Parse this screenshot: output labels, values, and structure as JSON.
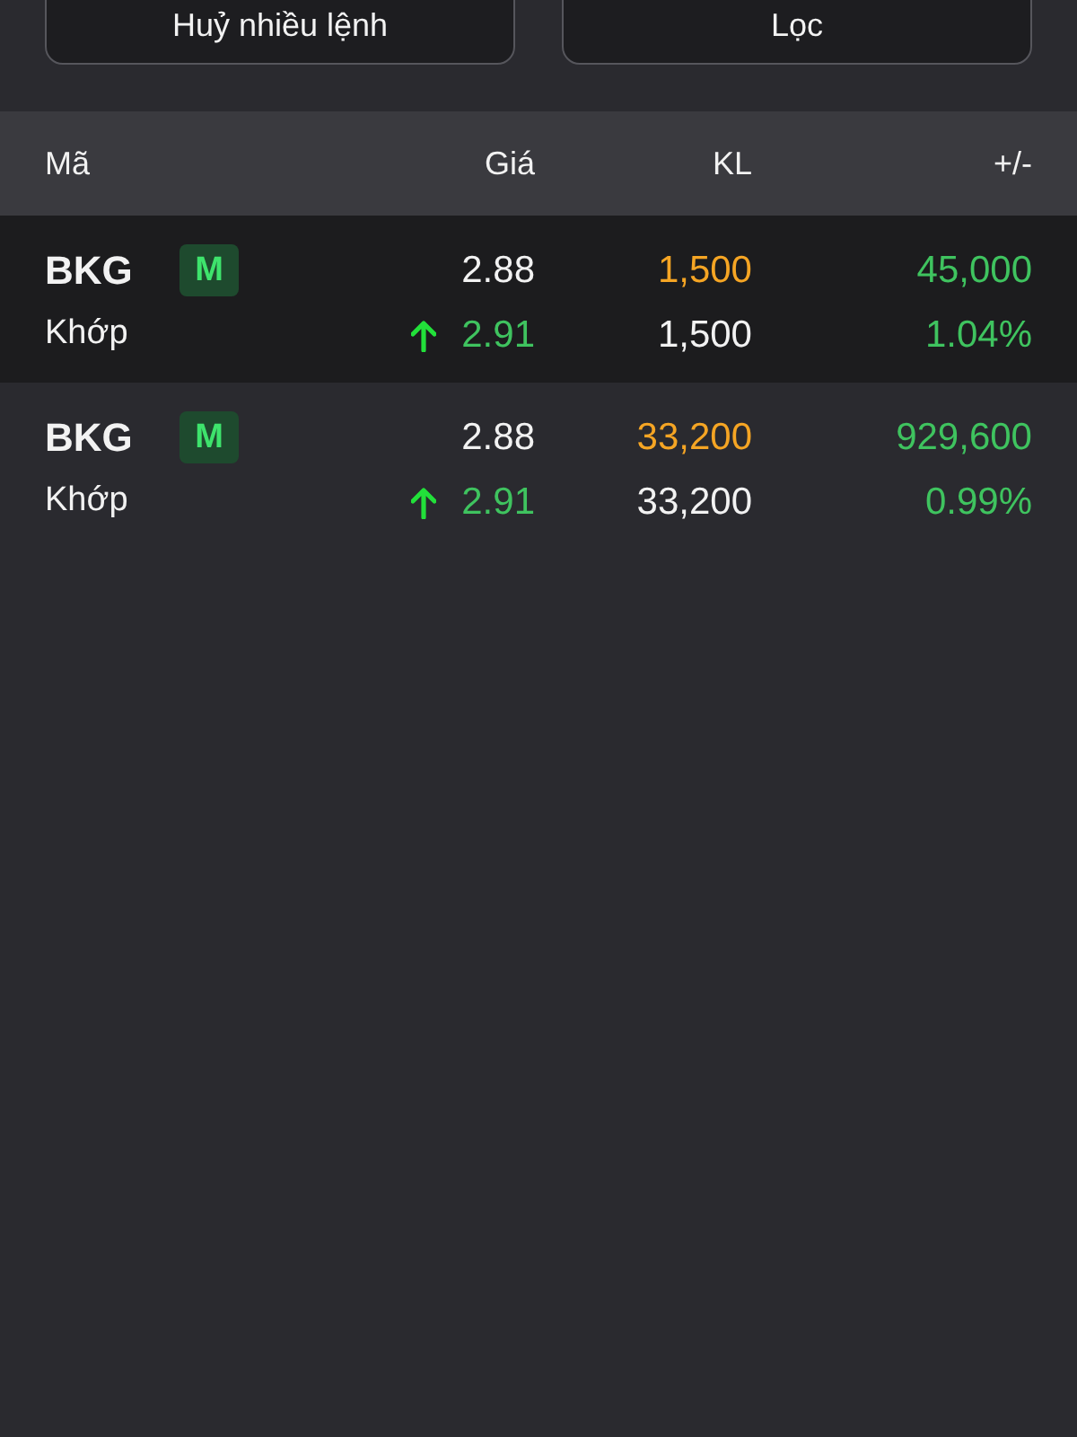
{
  "buttons": [
    {
      "label": "Huỷ nhiều lệnh"
    },
    {
      "label": "Lọc"
    }
  ],
  "table": {
    "columns": [
      "Mã",
      "Giá",
      "KL",
      "+/-"
    ],
    "rows": [
      {
        "selected": true,
        "symbol": "BKG",
        "badge": "M",
        "status": "Khớp",
        "price": "2.88",
        "rising": true,
        "matched_price": "2.91",
        "volume": "1,500",
        "matched_volume": "1,500",
        "change": "45,000",
        "change_percent": "1.04%"
      },
      {
        "selected": false,
        "symbol": "BKG",
        "badge": "M",
        "status": "Khớp",
        "price": "2.88",
        "rising": true,
        "matched_price": "2.91",
        "volume": "33,200",
        "matched_volume": "33,200",
        "change": "929,600",
        "change_percent": "0.99%"
      }
    ]
  }
}
